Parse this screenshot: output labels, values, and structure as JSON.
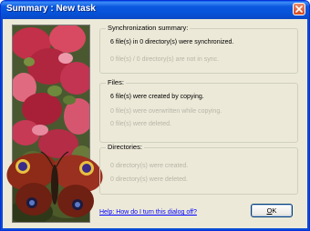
{
  "window": {
    "title": "Summary : New task"
  },
  "sync": {
    "label": "Synchronization summary:",
    "line1": "6 file(s) in 0 directory(s) were synchronized.",
    "line2": "0 file(s) / 0 directory(s) are not in sync."
  },
  "files": {
    "label": "Files:",
    "line1": "6 file(s) were created by copying.",
    "line2": "0 file(s) were overwritten while copying.",
    "line3": "0 file(s) were deleted."
  },
  "dirs": {
    "label": "Directories:",
    "line1": "0 directory(s) were created.",
    "line2": "0 directory(s) were deleted."
  },
  "help_link": "Help: How do I turn this dialog off?",
  "ok_button": {
    "first": "O",
    "rest": "K"
  },
  "colors": {
    "titlebar": "#0a5ce8",
    "window_bg": "#ece9d8",
    "disabled_text": "#b7b5a8",
    "link": "#0000ff"
  },
  "icons": {
    "close": "close-icon",
    "photo": "butterfly-flowers-image"
  }
}
